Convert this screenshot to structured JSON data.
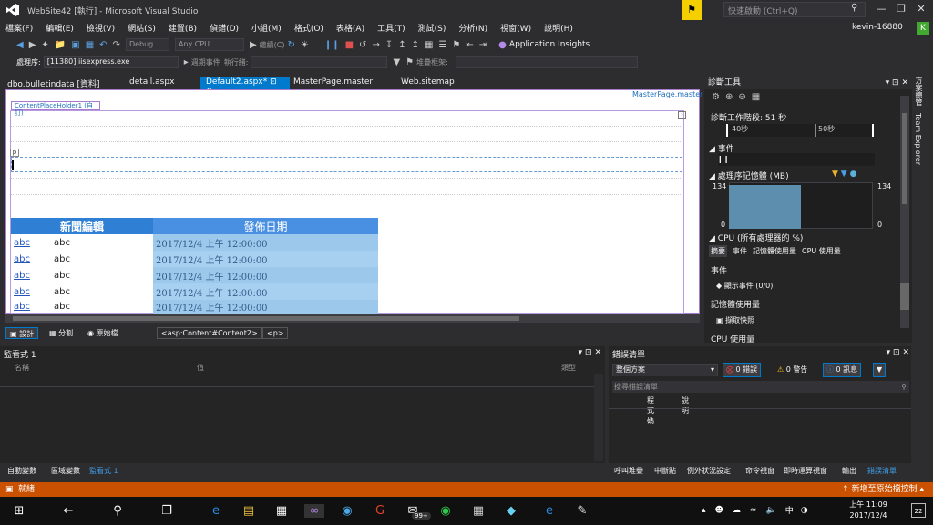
{
  "window": {
    "title": "WebSite42 [執行] - Microsoft Visual Studio",
    "quick_launch": "快速啟動 (Ctrl+Q)",
    "user": "kevin-16880",
    "avatar": "K"
  },
  "menu": [
    "檔案(F)",
    "編輯(E)",
    "檢視(V)",
    "網站(S)",
    "建置(B)",
    "偵錯(D)",
    "小組(M)",
    "格式(O)",
    "表格(A)",
    "工具(T)",
    "測試(S)",
    "分析(N)",
    "視窗(W)",
    "說明(H)"
  ],
  "toolbar": {
    "config": "Debug",
    "platform": "Any CPU",
    "continue": "繼續(C)",
    "app_insights": "Application Insights"
  },
  "toolbar2": {
    "process_label": "處理序:",
    "process": "[11380] iisexpress.exe",
    "lifecycle": "週期事件",
    "thread": "執行緒:",
    "stack": "堆疊框架:"
  },
  "tabs": [
    {
      "label": "dbo.bulletindata [資料]"
    },
    {
      "label": "detail.aspx"
    },
    {
      "label": "Default2.aspx*"
    },
    {
      "label": "MasterPage.master"
    },
    {
      "label": "Web.sitemap"
    }
  ],
  "designer": {
    "master_label": "MasterPage.master",
    "placeholder": "ContentPlaceHolder1 (自訂)",
    "p_tag": "p",
    "grid": {
      "headers": [
        "新聞編輯",
        "發佈日期"
      ],
      "rows": [
        {
          "link": "abc",
          "text": "abc",
          "date": "2017/12/4 上午 12:00:00"
        },
        {
          "link": "abc",
          "text": "abc",
          "date": "2017/12/4 上午 12:00:00"
        },
        {
          "link": "abc",
          "text": "abc",
          "date": "2017/12/4 上午 12:00:00"
        },
        {
          "link": "abc",
          "text": "abc",
          "date": "2017/12/4 上午 12:00:00"
        },
        {
          "link": "abc",
          "text": "abc",
          "date": "2017/12/4 上午 12:00:00"
        }
      ]
    }
  },
  "viewbar": {
    "design": "設計",
    "split": "分割",
    "source": "原始檔",
    "crumb1": "<asp:Content#Content2>",
    "crumb2": "<p>"
  },
  "diag": {
    "title": "診斷工具",
    "session": "診斷工作階段: 51 秒",
    "t40": "40秒",
    "t50": "50秒",
    "events": "事件",
    "memory": "處理序記憶體 (MB)",
    "mem_max": "134",
    "mem_min": "0",
    "mem_fill_fraction": 0.5,
    "cpu": "CPU (所有處理器的 %)",
    "tabs": [
      "摘要",
      "事件",
      "記憶體使用量",
      "CPU 使用量"
    ],
    "g_events": "事件",
    "show_events": "顯示事件 (0/0)",
    "g_memory": "記憶體使用量",
    "snapshot": "擷取快照",
    "g_cpu": "CPU 使用量"
  },
  "side_tabs": [
    "方案總管",
    "Team Explorer"
  ],
  "watch": {
    "title": "監看式 1",
    "col_name": "名稱",
    "col_value": "值",
    "col_type": "類型"
  },
  "errors": {
    "title": "錯誤清單",
    "filter": "整個方案",
    "err": "0 錯誤",
    "warn": "0 警告",
    "msg": "0 訊息",
    "search": "搜尋錯誤清單",
    "col_code": "程式碼",
    "col_desc": "說明"
  },
  "bottom_left_tabs": [
    "自動變數",
    "區域變數",
    "監看式 1"
  ],
  "bottom_right_tabs": [
    "呼叫堆疊",
    "中斷點",
    "例外狀況設定",
    "命令視窗",
    "即時運算視窗",
    "輸出",
    "錯誤清單"
  ],
  "status": {
    "ready": "就緒",
    "right": "新增至原始檔控制"
  },
  "taskbar": {
    "time": "上午 11:09",
    "date": "2017/12/4",
    "ime": "中",
    "notif": "22",
    "badge": "99+"
  }
}
